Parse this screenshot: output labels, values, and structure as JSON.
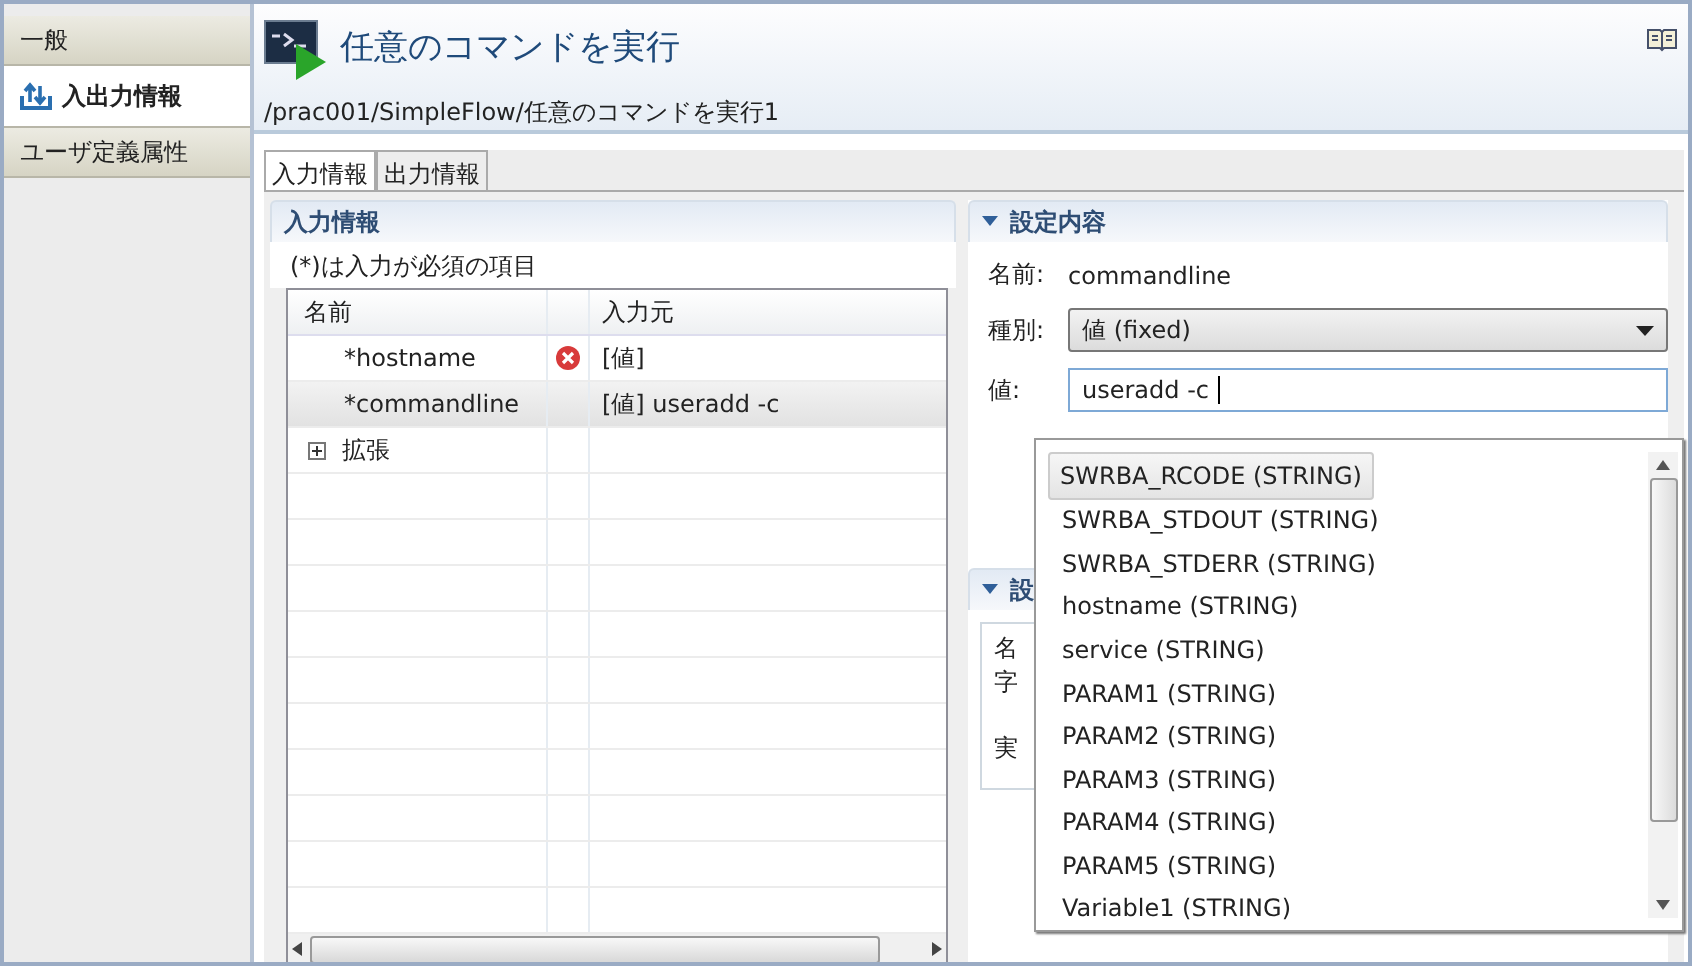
{
  "sidebar": {
    "items": [
      {
        "label": "一般",
        "selected": false
      },
      {
        "label": "入出力情報",
        "selected": true
      },
      {
        "label": "ユーザ定義属性",
        "selected": false
      }
    ]
  },
  "header": {
    "title": "任意のコマンドを実行",
    "path": "/prac001/SimpleFlow/任意のコマンドを実行1"
  },
  "tabs": [
    {
      "label": "入力情報",
      "selected": true
    },
    {
      "label": "出力情報",
      "selected": false
    }
  ],
  "input_section": {
    "title": "入力情報",
    "note": "(*)は入力が必須の項目",
    "table": {
      "columns": [
        "名前",
        "入力元"
      ],
      "rows": [
        {
          "kind": "param",
          "name": "*hostname",
          "error": true,
          "source": "[値]",
          "selected": false
        },
        {
          "kind": "param",
          "name": "*commandline",
          "error": false,
          "source": "[値] useradd -c",
          "selected": true
        },
        {
          "kind": "group",
          "name": "拡張",
          "expanded": false,
          "selected": false
        }
      ]
    }
  },
  "settings": {
    "title": "設定内容",
    "expanded": true,
    "name_label": "名前:",
    "name_value": "commandline",
    "type_label": "種別:",
    "type_value": "値 (fixed)",
    "value_label": "値:",
    "value": "useradd -c"
  },
  "section2": {
    "title": "設",
    "expanded": true,
    "lines": [
      "名",
      "字",
      "実"
    ]
  },
  "popup": {
    "items": [
      {
        "label": "SWRBA_RCODE (STRING)",
        "selected": true
      },
      {
        "label": "SWRBA_STDOUT (STRING)",
        "selected": false
      },
      {
        "label": "SWRBA_STDERR (STRING)",
        "selected": false
      },
      {
        "label": "hostname (STRING)",
        "selected": false
      },
      {
        "label": "service (STRING)",
        "selected": false
      },
      {
        "label": "PARAM1 (STRING)",
        "selected": false
      },
      {
        "label": "PARAM2 (STRING)",
        "selected": false
      },
      {
        "label": "PARAM3 (STRING)",
        "selected": false
      },
      {
        "label": "PARAM4 (STRING)",
        "selected": false
      },
      {
        "label": "PARAM5 (STRING)",
        "selected": false
      },
      {
        "label": "Variable1 (STRING)",
        "selected": false
      }
    ]
  }
}
